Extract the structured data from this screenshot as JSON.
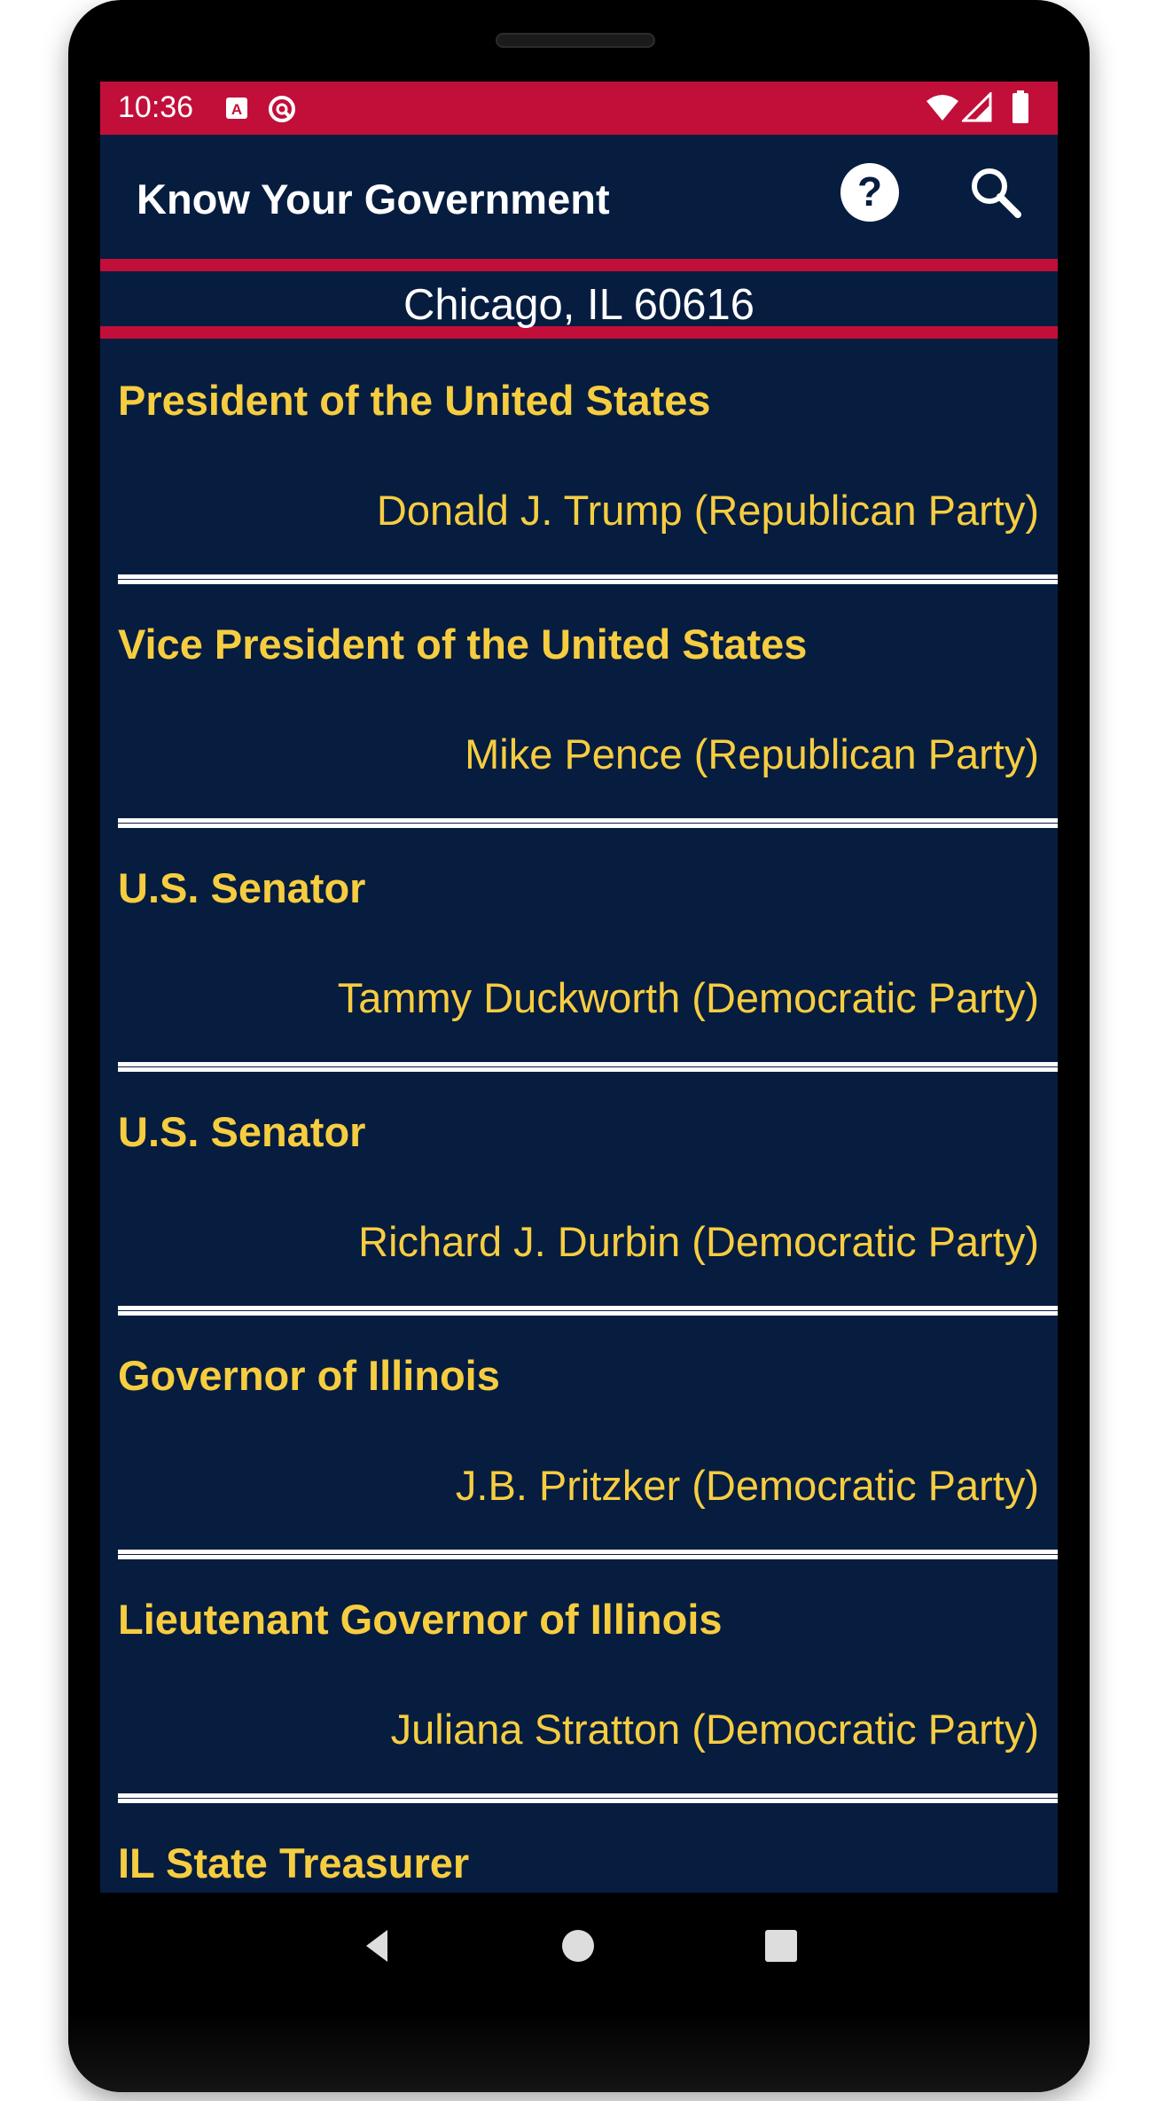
{
  "status": {
    "time": "10:36"
  },
  "toolbar": {
    "title": "Know Your Government",
    "help_icon": "help-circle-icon",
    "search_icon": "search-icon"
  },
  "location": {
    "text": "Chicago, IL 60616"
  },
  "officials": [
    {
      "office": "President of the United States",
      "official": "Donald J. Trump (Republican Party)"
    },
    {
      "office": "Vice President of the United States",
      "official": "Mike Pence (Republican Party)"
    },
    {
      "office": "U.S. Senator",
      "official": "Tammy Duckworth (Democratic Party)"
    },
    {
      "office": "U.S. Senator",
      "official": "Richard J. Durbin (Democratic Party)"
    },
    {
      "office": "Governor of Illinois",
      "official": "J.B. Pritzker (Democratic Party)"
    },
    {
      "office": "Lieutenant Governor of Illinois",
      "official": "Juliana Stratton (Democratic Party)"
    },
    {
      "office": "IL State Treasurer",
      "official": ""
    }
  ],
  "colors": {
    "status_bar": "#c10f3a",
    "background": "#061d40",
    "accent_text": "#f7cd40",
    "divider": "#ffffff"
  }
}
